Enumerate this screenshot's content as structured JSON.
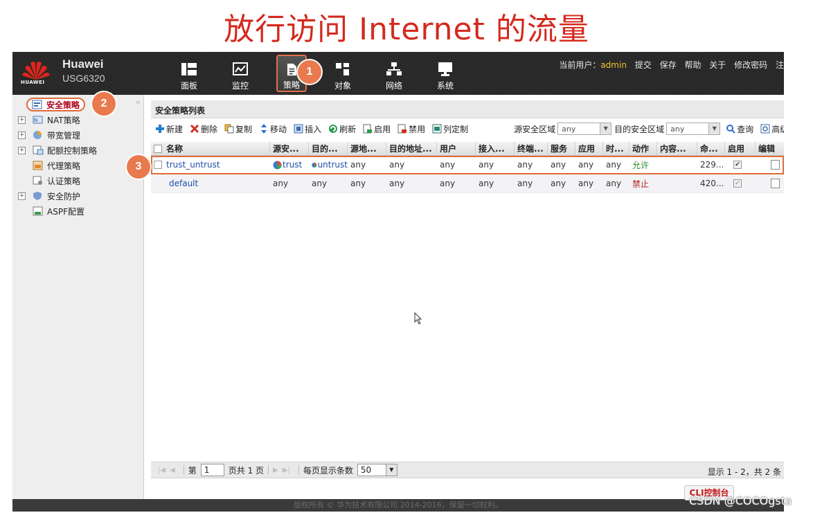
{
  "slide_title": "放行访问 Internet 的流量",
  "brand": {
    "logo_text": "HUAWEI",
    "name": "Huawei",
    "model": "USG6320"
  },
  "nav": [
    {
      "label": "面板",
      "icon": "dashboard-icon"
    },
    {
      "label": "监控",
      "icon": "monitor-chart-icon"
    },
    {
      "label": "策略",
      "icon": "policy-document-icon"
    },
    {
      "label": "对象",
      "icon": "object-icon"
    },
    {
      "label": "网络",
      "icon": "network-icon"
    },
    {
      "label": "系统",
      "icon": "system-monitor-icon"
    }
  ],
  "topright": {
    "user_label": "当前用户：",
    "user": "admin",
    "links": [
      "提交",
      "保存",
      "帮助",
      "关于",
      "修改密码",
      "注"
    ]
  },
  "sidebar": {
    "items": [
      {
        "label": "安全策略",
        "icon": "security-policy-icon",
        "expander": ""
      },
      {
        "label": "NAT策略",
        "icon": "nat-policy-icon",
        "expander": "+"
      },
      {
        "label": "带宽管理",
        "icon": "bandwidth-icon",
        "expander": "+"
      },
      {
        "label": "配额控制策略",
        "icon": "quota-icon",
        "expander": "+"
      },
      {
        "label": "代理策略",
        "icon": "proxy-icon",
        "expander": ""
      },
      {
        "label": "认证策略",
        "icon": "auth-icon",
        "expander": ""
      },
      {
        "label": "安全防护",
        "icon": "shield-icon",
        "expander": "+"
      },
      {
        "label": "ASPF配置",
        "icon": "aspf-icon",
        "expander": ""
      }
    ]
  },
  "panel": {
    "title": "安全策略列表"
  },
  "toolbar": {
    "buttons": [
      {
        "label": "新建",
        "icon": "plus-icon"
      },
      {
        "label": "删除",
        "icon": "delete-icon"
      },
      {
        "label": "复制",
        "icon": "copy-icon"
      },
      {
        "label": "移动",
        "icon": "move-icon"
      },
      {
        "label": "插入",
        "icon": "insert-icon"
      },
      {
        "label": "刷新",
        "icon": "refresh-icon"
      },
      {
        "label": "启用",
        "icon": "enable-icon"
      },
      {
        "label": "禁用",
        "icon": "disable-icon"
      },
      {
        "label": "列定制",
        "icon": "columns-icon"
      }
    ],
    "src_zone_label": "源安全区域",
    "src_zone_value": "any",
    "dst_zone_label": "目的安全区域",
    "dst_zone_value": "any",
    "query_label": "查询",
    "advanced_label": "高级"
  },
  "table": {
    "columns": [
      "名称",
      "源安...",
      "目的...",
      "源地...",
      "目的地址...",
      "用户",
      "接入...",
      "终端...",
      "服务",
      "应用",
      "时...",
      "动作",
      "内容...",
      "命...",
      "启用",
      "编辑"
    ],
    "rows": [
      {
        "name": "trust_untrust",
        "src": "trust",
        "dst": "untrust",
        "srcaddr": "any",
        "dstaddr": "any",
        "user": "any",
        "access": "any",
        "terminal": "any",
        "service": "any",
        "app": "any",
        "time": "any",
        "action": "允许",
        "content": "",
        "hits": "229...",
        "enabled": "✔"
      },
      {
        "name": "default",
        "src": "any",
        "dst": "any",
        "srcaddr": "any",
        "dstaddr": "any",
        "user": "any",
        "access": "any",
        "terminal": "any",
        "service": "any",
        "app": "any",
        "time": "any",
        "action": "禁止",
        "content": "",
        "hits": "420...",
        "enabled": "✔"
      }
    ]
  },
  "pager": {
    "page_prefix": "第",
    "page_value": "1",
    "page_suffix": "页共 1 页",
    "per_page_label": "每页显示条数",
    "per_page_value": "50",
    "summary": "显示 1 - 2，共 2 条"
  },
  "footer": {
    "text": "版权所有 © 华为技术有限公司 2014-2016，保留一切权利。"
  },
  "cli_button": "CLI控制台",
  "badges": [
    "1",
    "2",
    "3"
  ],
  "watermark": "CSDN @COCOgsta",
  "colors": {
    "accent_red": "#d42a1e",
    "highlight_orange": "#e06a3a",
    "allow_green": "#2b8a2b",
    "deny_red": "#b0201c"
  }
}
